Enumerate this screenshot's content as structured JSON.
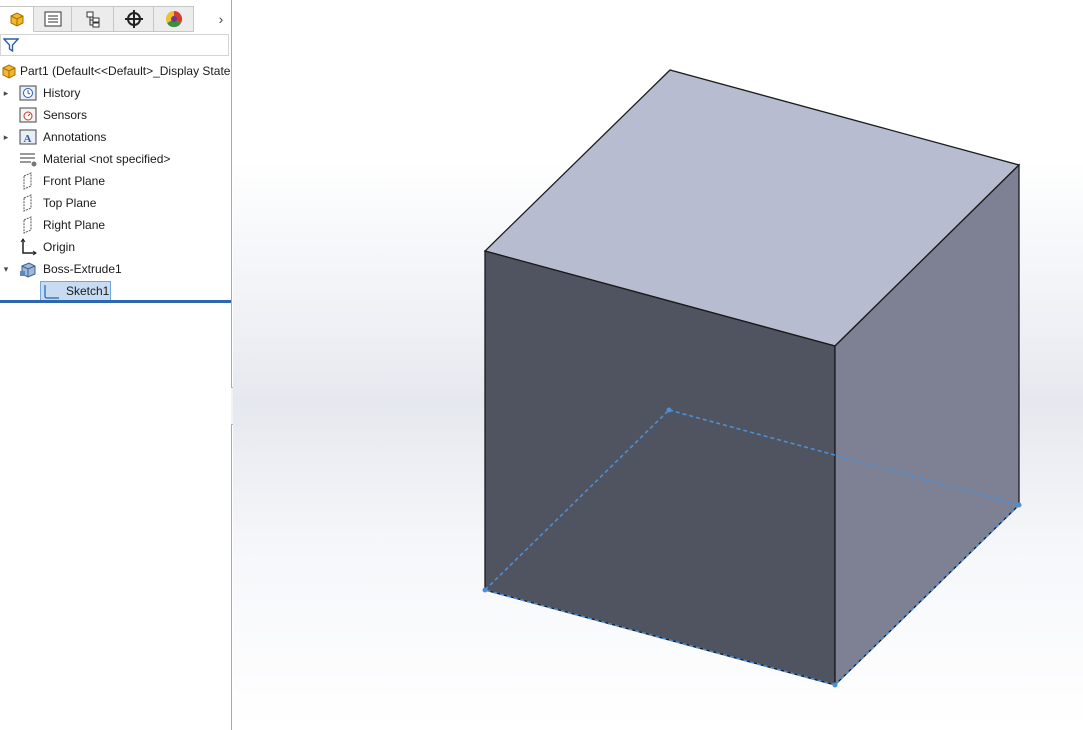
{
  "feature_tree": {
    "root_label": "Part1  (Default<<Default>_Display State",
    "items": [
      {
        "label": "History",
        "icon": "history-folder-icon",
        "expander": "▸"
      },
      {
        "label": "Sensors",
        "icon": "sensors-icon",
        "expander": ""
      },
      {
        "label": "Annotations",
        "icon": "annotations-icon",
        "expander": "▸"
      },
      {
        "label": "Material <not specified>",
        "icon": "material-icon",
        "expander": ""
      },
      {
        "label": "Front Plane",
        "icon": "plane-icon",
        "expander": ""
      },
      {
        "label": "Top Plane",
        "icon": "plane-icon",
        "expander": ""
      },
      {
        "label": "Right Plane",
        "icon": "plane-icon",
        "expander": ""
      },
      {
        "label": "Origin",
        "icon": "origin-icon",
        "expander": ""
      },
      {
        "label": "Boss-Extrude1",
        "icon": "extrude-icon",
        "expander": "▾"
      }
    ],
    "sketch": {
      "label": "Sketch1",
      "icon": "sketch-icon"
    }
  },
  "tabs": {
    "items": [
      {
        "name": "featuremanager-tab",
        "icon": "part-icon"
      },
      {
        "name": "propertymanager-tab",
        "icon": "property-list-icon"
      },
      {
        "name": "configurationmanager-tab",
        "icon": "configuration-icon"
      },
      {
        "name": "dimxpert-tab",
        "icon": "crosshair-icon"
      },
      {
        "name": "displaymanager-tab",
        "icon": "color-wheel-icon"
      }
    ],
    "more_arrow": "›"
  },
  "colors": {
    "cube_top": "#b8bcd1",
    "cube_front": "#505360",
    "cube_right": "#7e8193",
    "sketch_line": "#4a90d9",
    "selection_bg": "#c7dcf3",
    "rollback_bar": "#2d67b0"
  }
}
